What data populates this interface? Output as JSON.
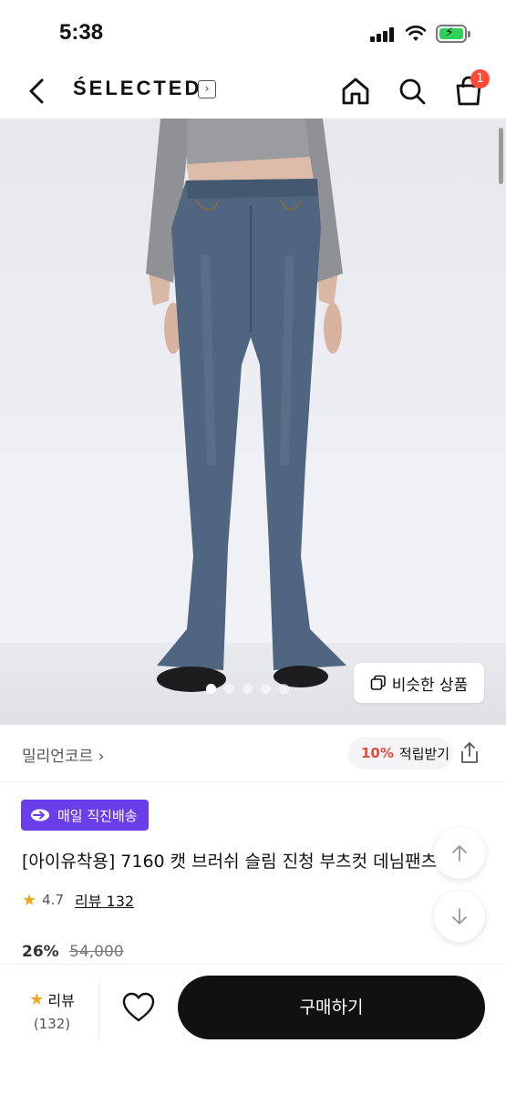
{
  "status": {
    "time": "5:38"
  },
  "nav": {
    "brand": "ŚELECTED",
    "brand_arrow": "›",
    "cart_count": "1"
  },
  "hero": {
    "similar_label": "비슷한 상품",
    "dots": 5,
    "active_dot": 0
  },
  "seller": {
    "name": "밀리언코르 ›",
    "points_pct": "10%",
    "points_label": "적립받기"
  },
  "product": {
    "delivery_badge": "매일 직진배송",
    "title": "[아이유착용] 7160 캣 브러쉬 슬림 진청 부츠컷 데님팬츠",
    "rating": "4.7",
    "review_link": "리뷰 132",
    "discount": "26%",
    "original_price": "54,000"
  },
  "bottom": {
    "review_label": "리뷰",
    "review_count": "(132)",
    "buy_label": "구매하기"
  },
  "colors": {
    "accent_purple": "#6a3ee8",
    "badge_red": "#ff4b3a",
    "points_red": "#e84a3f",
    "star": "#f5a623"
  }
}
